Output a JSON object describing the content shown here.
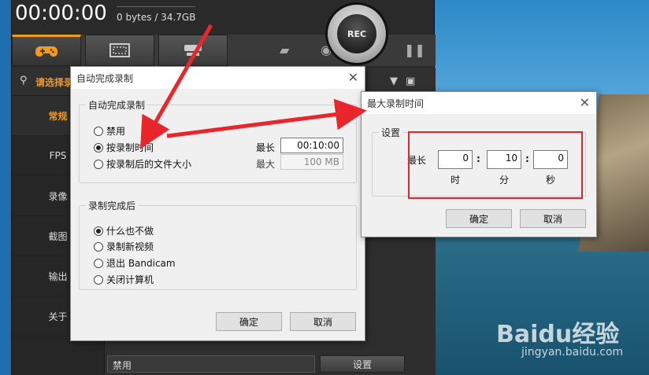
{
  "colors": {
    "accent": "#f39a1e",
    "arrow": "#e8262c",
    "highlight": "#d9292e"
  },
  "main": {
    "timer": "00:00:00",
    "bytes": "0 bytes / 34.7GB",
    "rec_label": "REC",
    "search_label": "请选择录",
    "menu": [
      "常规",
      "FPS",
      "录像",
      "截图",
      "输出",
      "关于"
    ],
    "bottom_field": "禁用",
    "bottom_button": "设置",
    "icons": [
      "gamepad-icon",
      "screen-icon",
      "hdmi-icon",
      "folder-icon",
      "camera-icon",
      "pause-icon",
      "search-icon",
      "minimize-icon",
      "window-icon"
    ]
  },
  "dialog1": {
    "title": "自动完成录制",
    "group1_title": "自动完成录制",
    "options": [
      "禁用",
      "按录制时间",
      "按录制后的文件大小"
    ],
    "selected": 1,
    "max_time_label": "最长",
    "max_time_value": "00:10:00",
    "max_size_label": "最大",
    "max_size_value": "100 MB",
    "group2_title": "录制完成后",
    "after_options": [
      "什么也不做",
      "录制新视频",
      "退出 Bandicam",
      "关闭计算机"
    ],
    "after_selected": 0,
    "ok": "确定",
    "cancel": "取消"
  },
  "dialog2": {
    "title": "最大录制时间",
    "group_title": "设置",
    "max_label": "最长",
    "hours": "0",
    "minutes": "10",
    "seconds": "0",
    "hours_unit": "时",
    "minutes_unit": "分",
    "seconds_unit": "秒",
    "ok": "确定",
    "cancel": "取消"
  },
  "watermark": {
    "logo": "Baidu经验",
    "url": "jingyan.baidu.com"
  }
}
